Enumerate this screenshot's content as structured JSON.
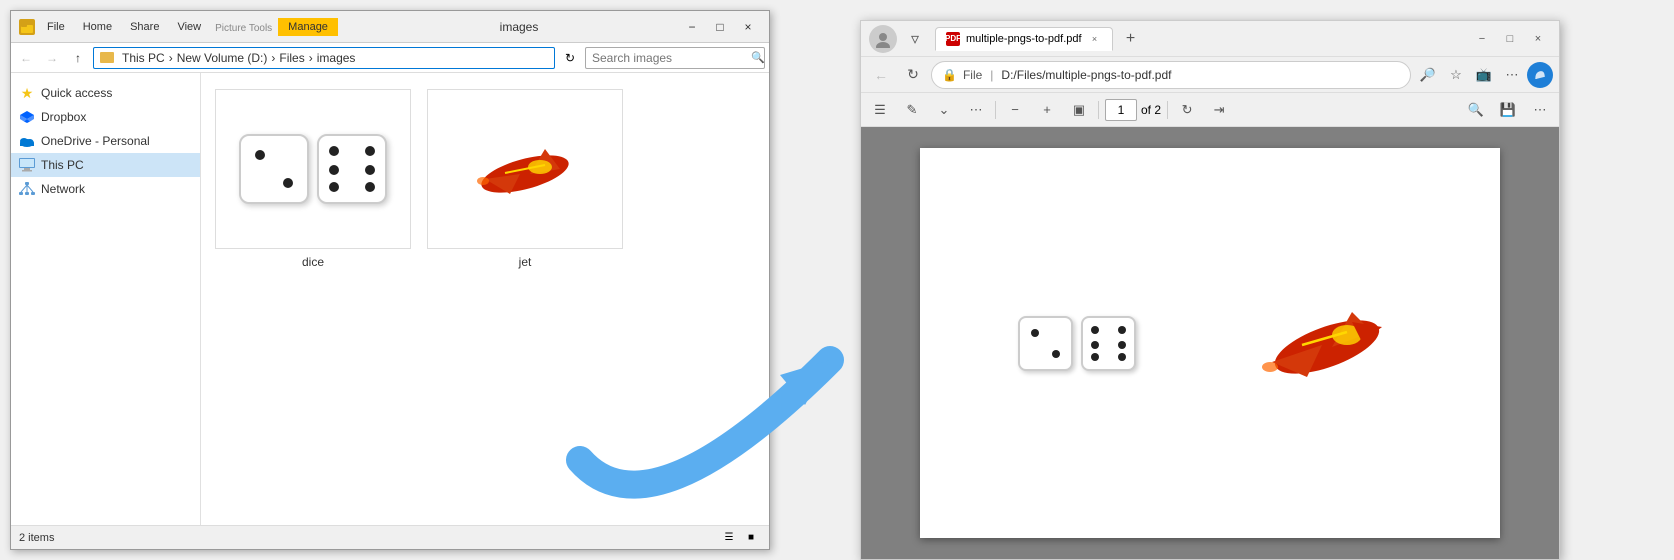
{
  "explorer": {
    "title": "images",
    "ribbon": {
      "manage_label": "Manage",
      "picture_tools_label": "Picture Tools",
      "tabs": [
        "File",
        "Home",
        "Share",
        "View"
      ]
    },
    "addressbar": {
      "path": "This PC > New Volume (D:) > Files > images",
      "search_placeholder": "Search images"
    },
    "sidebar": {
      "items": [
        {
          "label": "Quick access",
          "icon": "star"
        },
        {
          "label": "Dropbox",
          "icon": "dropbox"
        },
        {
          "label": "OneDrive - Personal",
          "icon": "cloud"
        },
        {
          "label": "This PC",
          "icon": "computer",
          "selected": true
        },
        {
          "label": "Network",
          "icon": "network"
        }
      ]
    },
    "files": [
      {
        "name": "dice",
        "type": "image"
      },
      {
        "name": "jet",
        "type": "image"
      }
    ],
    "statusbar": {
      "item_count": "2 items",
      "view_options": [
        "list",
        "grid"
      ]
    }
  },
  "browser": {
    "tab": {
      "title": "multiple-pngs-to-pdf.pdf",
      "icon": "pdf"
    },
    "address": {
      "protocol": "File",
      "path": "D:/Files/multiple-pngs-to-pdf.pdf"
    },
    "toolbar": {
      "current_page": "1",
      "total_pages": "of 2"
    },
    "window_controls": {
      "minimize": "−",
      "maximize": "□",
      "close": "×"
    }
  }
}
